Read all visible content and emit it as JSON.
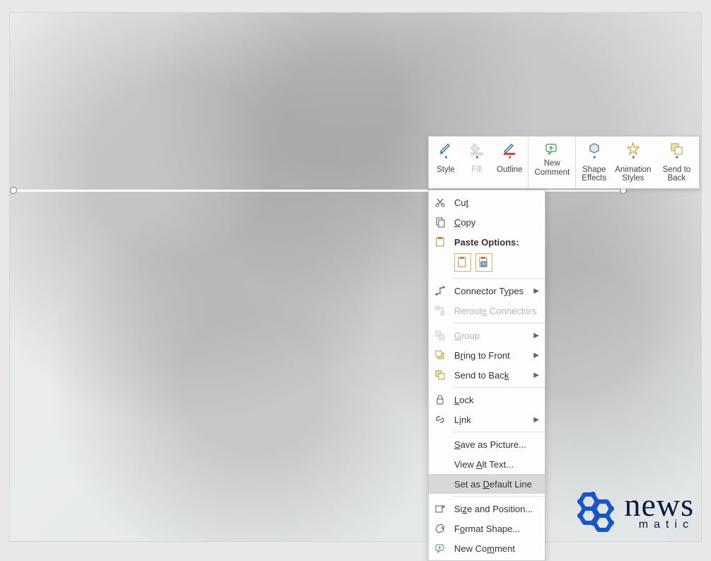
{
  "mini_toolbar": {
    "style": "Style",
    "fill": "Fill",
    "outline": "Outline",
    "new_comment": "New\nComment",
    "shape_effects": "Shape\nEffects",
    "animation_styles": "Animation\nStyles",
    "send_to_back": "Send to\nBack"
  },
  "context_menu": {
    "cut": "Cut",
    "copy": "Copy",
    "paste_options": "Paste Options:",
    "connector_types": "Connector Types",
    "reroute_connectors": "Reroute Connectors",
    "group": "Group",
    "bring_to_front": "Bring to Front",
    "send_to_back": "Send to Back",
    "lock": "Lock",
    "link": "Link",
    "save_as_picture": "Save as Picture...",
    "view_alt_text": "View Alt Text...",
    "set_as_default_line": "Set as Default Line",
    "size_and_position": "Size and Position...",
    "format_shape": "Format Shape...",
    "new_comment": "New Comment"
  },
  "logo": {
    "brand": "news",
    "sub": "matic"
  }
}
